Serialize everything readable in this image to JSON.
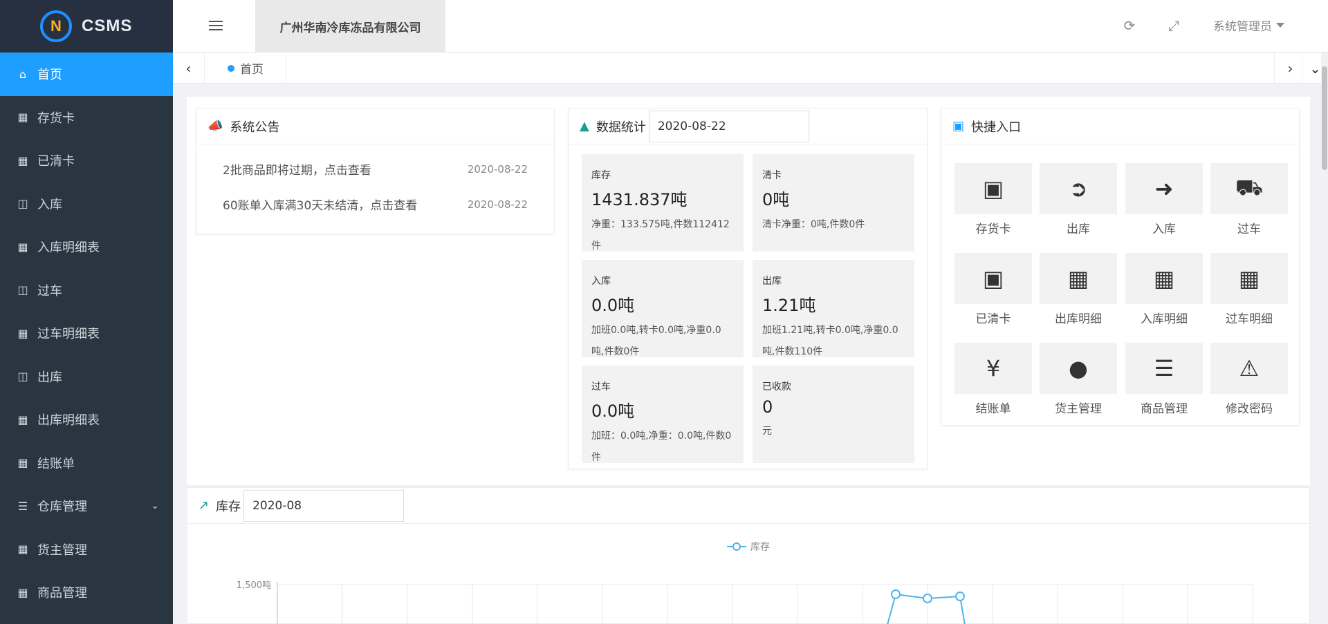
{
  "app": {
    "name": "CSMS",
    "company": "广州华南冷库冻品有限公司",
    "user": "系统管理员"
  },
  "sidebar": {
    "items": [
      {
        "label": "首页",
        "icon": "home-icon",
        "active": true
      },
      {
        "label": "存货卡",
        "icon": "grid-icon"
      },
      {
        "label": "已清卡",
        "icon": "grid-icon"
      },
      {
        "label": "入库",
        "icon": "excel-file-icon"
      },
      {
        "label": "入库明细表",
        "icon": "table-icon"
      },
      {
        "label": "过车",
        "icon": "excel-file-icon"
      },
      {
        "label": "过车明细表",
        "icon": "table-icon"
      },
      {
        "label": "出库",
        "icon": "excel-file-icon"
      },
      {
        "label": "出库明细表",
        "icon": "table-icon"
      },
      {
        "label": "结账单",
        "icon": "grid-icon"
      },
      {
        "label": "仓库管理",
        "icon": "list-icon",
        "expandable": true
      },
      {
        "label": "货主管理",
        "icon": "grid-icon"
      },
      {
        "label": "商品管理",
        "icon": "grid-icon"
      }
    ]
  },
  "tabs": {
    "current": "首页"
  },
  "notice": {
    "title": "系统公告",
    "items": [
      {
        "text": "2批商品即将过期，点击查看",
        "date": "2020-08-22"
      },
      {
        "text": "60账单入库满30天未结清，点击查看",
        "date": "2020-08-22"
      }
    ]
  },
  "stats": {
    "title": "数据统计",
    "date": "2020-08-22",
    "boxes": [
      {
        "label": "库存",
        "value": "1431.837吨",
        "detail": "净重：133.575吨,件数112412件"
      },
      {
        "label": "清卡",
        "value": "0吨",
        "detail": "清卡净重：0吨,件数0件"
      },
      {
        "label": "入库",
        "value": "0.0吨",
        "detail": "加班0.0吨,转卡0.0吨,净重0.0吨,件数0件"
      },
      {
        "label": "出库",
        "value": "1.21吨",
        "detail": "加班1.21吨,转卡0.0吨,净重0.0吨,件数110件"
      },
      {
        "label": "过车",
        "value": "0.0吨",
        "detail": "加班：0.0吨,净重：0.0吨,件数0件"
      },
      {
        "label": "已收款",
        "value": "0",
        "detail": "元"
      }
    ]
  },
  "quick": {
    "title": "快捷入口",
    "items": [
      {
        "label": "存货卡",
        "icon": "credit-card-icon"
      },
      {
        "label": "出库",
        "icon": "sign-out-icon"
      },
      {
        "label": "入库",
        "icon": "sign-in-icon"
      },
      {
        "label": "过车",
        "icon": "truck-icon"
      },
      {
        "label": "已清卡",
        "icon": "credit-card-icon"
      },
      {
        "label": "出库明细",
        "icon": "calendar-icon"
      },
      {
        "label": "入库明细",
        "icon": "calendar-icon"
      },
      {
        "label": "过车明细",
        "icon": "calendar-icon"
      },
      {
        "label": "结账单",
        "icon": "yen-icon"
      },
      {
        "label": "货主管理",
        "icon": "user-icon"
      },
      {
        "label": "商品管理",
        "icon": "bars-icon"
      },
      {
        "label": "修改密码",
        "icon": "warning-icon"
      }
    ]
  },
  "inventory_chart": {
    "title": "库存",
    "month": "2020-08",
    "legend": "库存",
    "ytick": "1,500吨"
  },
  "colors": {
    "accent": "#1e9fff",
    "sidebar": "#2a3542",
    "line": "#4fb3e8"
  }
}
